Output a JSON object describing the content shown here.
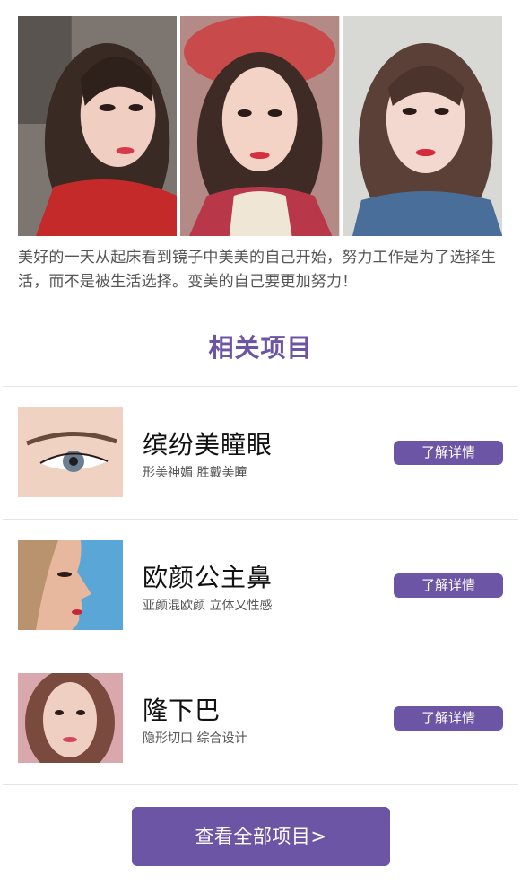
{
  "photos": [
    {
      "icon": "portrait-photo-1"
    },
    {
      "icon": "portrait-photo-2"
    },
    {
      "icon": "portrait-photo-3"
    }
  ],
  "caption": "美好的一天从起床看到镜子中美美的自己开始，努力工作是为了选择生活，而不是被生活选择。变美的自己要更加努力！",
  "section_title": "相关项目",
  "items": [
    {
      "title": "缤纷美瞳眼",
      "subtitle": "形美神媚 胜戴美瞳",
      "button": "了解详情",
      "icon": "eye-thumbnail"
    },
    {
      "title": "欧颜公主鼻",
      "subtitle": "亚颜混欧颜 立体又性感",
      "button": "了解详情",
      "icon": "nose-profile-thumbnail"
    },
    {
      "title": "隆下巴",
      "subtitle": "隐形切口 综合设计",
      "button": "了解详情",
      "icon": "face-thumbnail"
    }
  ],
  "view_all": "查看全部项目>",
  "colors": {
    "accent": "#6d55a5",
    "divider": "#e5e5e5"
  }
}
